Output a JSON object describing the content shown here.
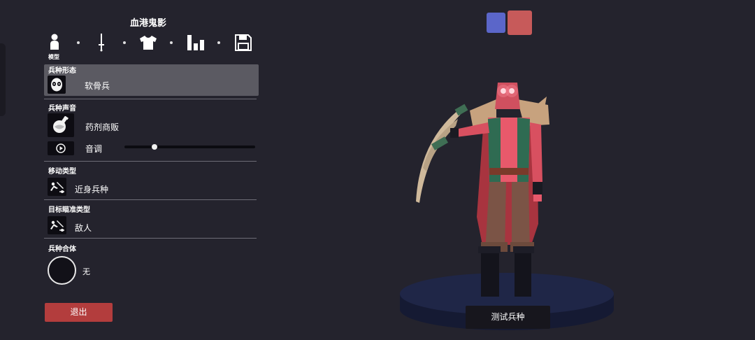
{
  "header": {
    "title": "血港鬼影"
  },
  "tabs": {
    "active_label": "模型",
    "items": [
      "model-icon",
      "sword-icon",
      "shirt-icon",
      "stats-icon",
      "save-icon"
    ]
  },
  "unit_form": {
    "label": "兵种形态",
    "value": "软骨兵",
    "icon": "skull-mask-icon"
  },
  "unit_voice": {
    "label": "兵种声音",
    "value": "药剂商贩",
    "icon": "potion-icon",
    "pitch_label": "音调",
    "pitch_level": 0.23
  },
  "movement": {
    "label": "移动类型",
    "value": "近身兵种",
    "icon": "melee-icon"
  },
  "targeting": {
    "label": "目标瞄准类型",
    "value": "敌人",
    "icon": "melee-icon"
  },
  "combine": {
    "label": "兵种合体",
    "value": "无"
  },
  "exit_label": "退出",
  "team_colors": {
    "blue": "#5b66c9",
    "red": "#c75a5a"
  },
  "test_label": "测试兵种",
  "colors": {
    "background": "#24232d",
    "panel_selected": "#5b5a62",
    "exit": "#b33d3d",
    "platform": "#1e2340"
  }
}
